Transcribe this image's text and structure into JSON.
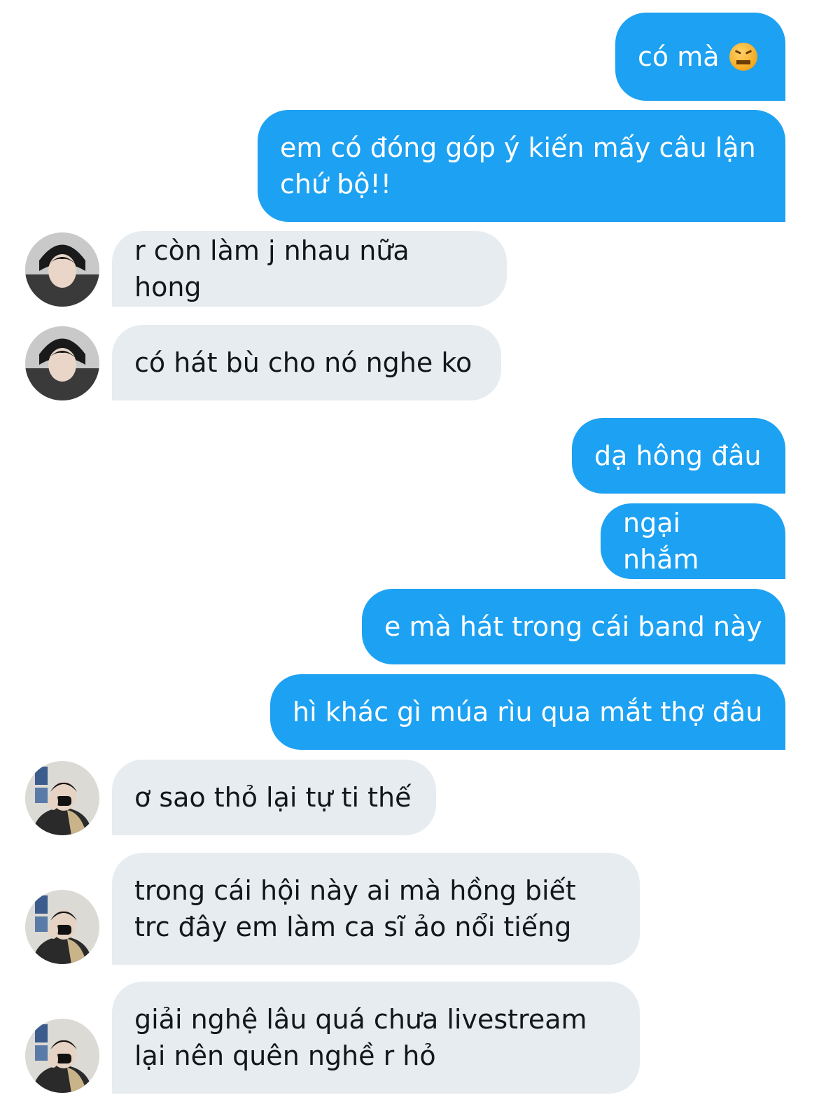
{
  "messages": [
    {
      "side": "out",
      "text": "có mà",
      "emoji": "confounded-face-emoji"
    },
    {
      "side": "out",
      "text": "em có đóng góp ý kiến mấy câu lận\nchứ bộ!!"
    },
    {
      "side": "in",
      "avatar": "avatar-1",
      "text": "r còn làm j nhau nữa hong"
    },
    {
      "side": "in",
      "avatar": "avatar-1",
      "text": "có hát bù cho nó nghe ko"
    },
    {
      "side": "out",
      "text": "dạ hông đâu"
    },
    {
      "side": "out",
      "text": "ngại nhắm"
    },
    {
      "side": "out",
      "text": "e mà hát trong cái band này"
    },
    {
      "side": "out",
      "text": "hì khác gì múa rìu qua mắt thợ đâu"
    },
    {
      "side": "in",
      "avatar": "avatar-2",
      "text": "ơ sao thỏ lại tự ti thế"
    },
    {
      "side": "in",
      "avatar": "avatar-2",
      "text": "trong cái hội này ai mà hồng biết\ntrc đây em làm ca sĩ ảo nổi tiếng"
    },
    {
      "side": "in",
      "avatar": "avatar-2",
      "text": "giải nghệ lâu quá chưa livestream\nlại nên quên nghề r hỏ"
    }
  ],
  "colors": {
    "outgoing_bubble": "#1da1f2",
    "incoming_bubble": "#e6ecf0"
  }
}
